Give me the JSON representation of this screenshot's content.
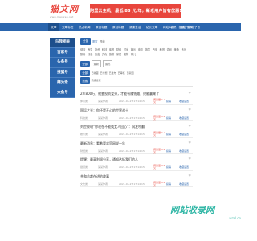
{
  "header": {
    "logo_text": "猫文网",
    "logo_sub": "www.maowen.net",
    "banner_text": "阿里云主机，最低 88 元/年，新老用户皆有优惠!"
  },
  "nav": {
    "items": [
      "文章",
      "文章标签",
      "热点新闻",
      "原创标题",
      "原创标题",
      "健康生活",
      "站长文章",
      "网站SEO",
      "建站PDF电子书",
      "站长经验"
    ],
    "right": [
      "会员",
      "投稿",
      "登录"
    ]
  },
  "sidebar": {
    "items": [
      "与我相关",
      "百家号",
      "头条号",
      "搜狐号",
      "趣头条",
      "大鱼号"
    ]
  },
  "filters": {
    "primary": "全部",
    "tags_row1": [
      "图文",
      "视频",
      "健康",
      "养生",
      "投资",
      "科技",
      "体育",
      "财经",
      "时尚",
      "娱乐",
      "电影",
      "搞笑",
      "汽车",
      "教育",
      "游戏",
      "美食",
      "音乐",
      "数码",
      "动漫",
      "历史",
      "文化",
      "旅游",
      "家居",
      "宠物",
      "育儿"
    ],
    "row2_primary": "全部",
    "row2_tags": [
      "最新",
      "最热",
      "最早",
      "热门推荐",
      "精选文章"
    ],
    "sort_primary": "全部",
    "sort_tags": [
      "已收藏",
      "已付费",
      "已发布",
      "已审核",
      "已驳回"
    ],
    "action_primary": "搜索",
    "action_secondary": "高级搜索"
  },
  "items": [
    {
      "title": "2年800万，他靠投资爱分，才能有赚钱路，终能赢来了",
      "source": "体育类",
      "author": "某某作者",
      "time": "2021-05-27 17:14:15",
      "count": "阅读量 1.2万",
      "action": "投稿",
      "link": "收藏设置"
    },
    {
      "title": "国运之光：你还是开心的世界战士",
      "source": "科技类",
      "author": "某某作者",
      "time": "2021-05-27 17:14:15",
      "count": "阅读量 1.2万",
      "action": "投稿",
      "link": "收藏设置"
    },
    {
      "title": "刘世俊明“你现在不能找女人回心”：网友吵翻",
      "source": "娱乐类",
      "author": "某某作者",
      "time": "2021-05-27 17:14:15",
      "count": "阅读量 1.2万",
      "action": "投稿",
      "link": "收藏设置"
    },
    {
      "title": "最新消息：看着要求官网说一年",
      "source": "财经类",
      "author": "某某作者",
      "time": "2021-05-27 17:14:15",
      "count": "阅读量 1.2万",
      "action": "投稿",
      "link": "收藏设置"
    },
    {
      "title": "提醒：最高利润分享，通知达标我们的人",
      "source": "健康类",
      "author": "某某作者",
      "time": "2021-05-27 17:14:15",
      "count": "阅读量 1.2万",
      "action": "投稿",
      "link": "收藏设置"
    },
    {
      "title": "共和总裁在讲的故事",
      "source": "文化类",
      "author": "某某作者",
      "time": "2021-05-27 17:14:15",
      "count": "阅读量 1.2万",
      "action": "投稿",
      "link": "收藏设置"
    }
  ],
  "watermark": {
    "main": "网站收录网",
    "sub": "wzsl.cn"
  },
  "colors": {
    "accent": "#2a65ad",
    "brand": "#e8453c",
    "watermark": "#2fb6a5"
  }
}
